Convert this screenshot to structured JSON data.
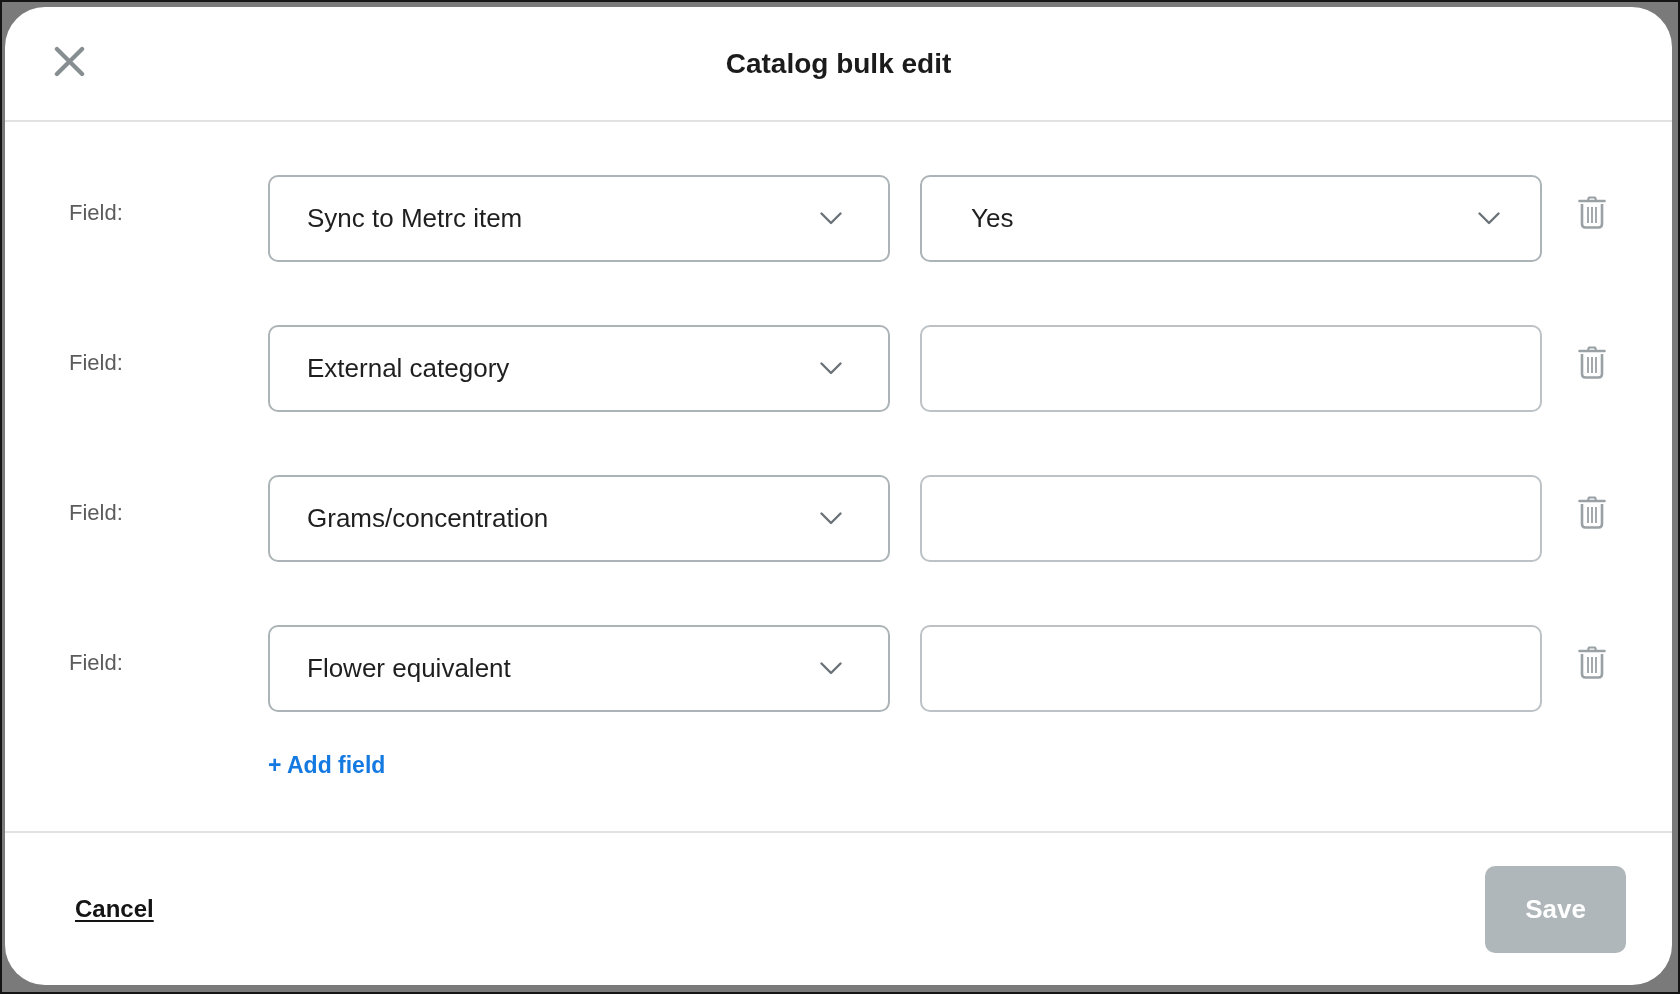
{
  "dialog": {
    "title": "Catalog bulk edit",
    "rows": [
      {
        "label": "Field:",
        "field_select": {
          "value": "Sync to Metrc item"
        },
        "value_control": {
          "kind": "select",
          "value": "Yes"
        }
      },
      {
        "label": "Field:",
        "field_select": {
          "value": "External category"
        },
        "value_control": {
          "kind": "input"
        }
      },
      {
        "label": "Field:",
        "field_select": {
          "value": "Grams/concentration"
        },
        "value_control": {
          "kind": "input"
        }
      },
      {
        "label": "Field:",
        "field_select": {
          "value": "Flower equivalent"
        },
        "value_control": {
          "kind": "input"
        }
      }
    ],
    "add_field_link": "+ Add field",
    "footer": {
      "cancel_link": "Cancel",
      "save_button": {
        "label": "Save",
        "disabled": true
      }
    }
  }
}
